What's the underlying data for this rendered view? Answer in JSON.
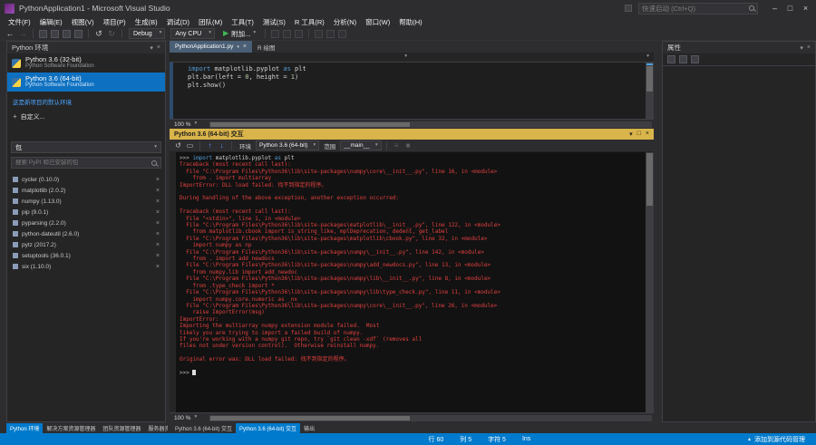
{
  "window": {
    "title": "PythonApplication1 - Microsoft Visual Studio"
  },
  "titlebar": {
    "quick_launch_placeholder": "快速启动 (Ctrl+Q)"
  },
  "menubar": {
    "items": [
      "文件(F)",
      "编辑(E)",
      "视图(V)",
      "项目(P)",
      "生成(B)",
      "调试(D)",
      "团队(M)",
      "工具(T)",
      "测试(S)",
      "R 工具(R)",
      "分析(N)",
      "窗口(W)",
      "帮助(H)"
    ]
  },
  "toolbar": {
    "config_combo": "Debug",
    "platform_combo": "Any CPU",
    "attach_label": "附加..."
  },
  "env_panel": {
    "title": "Python 环境",
    "environments": [
      {
        "name": "Python 3.6 (32-bit)",
        "vendor": "Python Software Foundation",
        "selected": false
      },
      {
        "name": "Python 3.6 (64-bit)",
        "vendor": "Python Software Foundation",
        "selected": true
      }
    ],
    "default_note": "这是新项目的默认环境",
    "customize_label": "自定义...",
    "view_combo": "包",
    "search_placeholder": "搜索 PyPI 和已安装的包",
    "packages": [
      {
        "name": "cycler (0.10.0)"
      },
      {
        "name": "matplotlib (2.0.2)"
      },
      {
        "name": "numpy (1.13.0)"
      },
      {
        "name": "pip (9.0.1)"
      },
      {
        "name": "pyparsing (2.2.0)"
      },
      {
        "name": "python-dateutil (2.6.0)"
      },
      {
        "name": "pytz (2017.2)"
      },
      {
        "name": "setuptools (36.0.1)"
      },
      {
        "name": "six (1.10.0)"
      }
    ]
  },
  "editor": {
    "tabs": [
      {
        "label": "PythonApplication1.py",
        "active": true
      },
      {
        "label": "R 绘图",
        "active": false
      }
    ],
    "zoom": "100 %",
    "code_lines": [
      {
        "tokens": [
          {
            "c": "kw",
            "t": "import"
          },
          {
            "c": "id",
            "t": " matplotlib.pyplot "
          },
          {
            "c": "kw",
            "t": "as"
          },
          {
            "c": "id",
            "t": " plt"
          }
        ]
      },
      {
        "tokens": [
          {
            "c": "id",
            "t": "plt.bar(left = "
          },
          {
            "c": "num",
            "t": "0"
          },
          {
            "c": "id",
            "t": ", height = "
          },
          {
            "c": "num",
            "t": "1"
          },
          {
            "c": "id",
            "t": ")"
          }
        ]
      },
      {
        "tokens": [
          {
            "c": "id",
            "t": "plt.show()"
          }
        ]
      }
    ]
  },
  "interactive": {
    "title": "Python 3.6 (64-bit) 交互",
    "env_label": "环境",
    "env_value": "Python 3.6 (64-bit)",
    "scope_label": "范围",
    "scope_value": "__main__",
    "zoom": "100 %",
    "lines": [
      {
        "c": "in",
        "tokens": [
          {
            "c": "prompt",
            "t": ">>> "
          },
          {
            "c": "kw",
            "t": "import"
          },
          {
            "c": "id",
            "t": " matplotlib.pyplot "
          },
          {
            "c": "kw",
            "t": "as"
          },
          {
            "c": "id",
            "t": " plt"
          }
        ]
      },
      {
        "c": "err",
        "t": "Traceback (most recent call last):"
      },
      {
        "c": "err",
        "t": "  File \"C:\\Program Files\\Python36\\lib\\site-packages\\numpy\\core\\__init__.py\", line 16, in <module>"
      },
      {
        "c": "err",
        "t": "    from . import multiarray"
      },
      {
        "c": "err",
        "t": "ImportError: DLL load failed: 找不到指定的程序。"
      },
      {
        "c": "blank",
        "t": ""
      },
      {
        "c": "err",
        "t": "During handling of the above exception, another exception occurred:"
      },
      {
        "c": "blank",
        "t": ""
      },
      {
        "c": "err",
        "t": "Traceback (most recent call last):"
      },
      {
        "c": "err",
        "t": "  File \"<stdin>\", line 1, in <module>"
      },
      {
        "c": "err",
        "t": "  File \"C:\\Program Files\\Python36\\lib\\site-packages\\matplotlib\\__init__.py\", line 122, in <module>"
      },
      {
        "c": "err",
        "t": "    from matplotlib.cbook import is_string_like, mplDeprecation, dedent, get_label"
      },
      {
        "c": "err",
        "t": "  File \"C:\\Program Files\\Python36\\lib\\site-packages\\matplotlib\\cbook.py\", line 32, in <module>"
      },
      {
        "c": "err",
        "t": "    import numpy as np"
      },
      {
        "c": "err",
        "t": "  File \"C:\\Program Files\\Python36\\lib\\site-packages\\numpy\\__init__.py\", line 142, in <module>"
      },
      {
        "c": "err",
        "t": "    from . import add_newdocs"
      },
      {
        "c": "err",
        "t": "  File \"C:\\Program Files\\Python36\\lib\\site-packages\\numpy\\add_newdocs.py\", line 13, in <module>"
      },
      {
        "c": "err",
        "t": "    from numpy.lib import add_newdoc"
      },
      {
        "c": "err",
        "t": "  File \"C:\\Program Files\\Python36\\lib\\site-packages\\numpy\\lib\\__init__.py\", line 8, in <module>"
      },
      {
        "c": "err",
        "t": "    from .type_check import *"
      },
      {
        "c": "err",
        "t": "  File \"C:\\Program Files\\Python36\\lib\\site-packages\\numpy\\lib\\type_check.py\", line 11, in <module>"
      },
      {
        "c": "err",
        "t": "    import numpy.core.numeric as _nx"
      },
      {
        "c": "err",
        "t": "  File \"C:\\Program Files\\Python36\\lib\\site-packages\\numpy\\core\\__init__.py\", line 26, in <module>"
      },
      {
        "c": "err",
        "t": "    raise ImportError(msg)"
      },
      {
        "c": "err",
        "t": "ImportError:"
      },
      {
        "c": "err",
        "t": "Importing the multiarray numpy extension module failed.  Most"
      },
      {
        "c": "err",
        "t": "likely you are trying to import a failed build of numpy."
      },
      {
        "c": "err",
        "t": "If you're working with a numpy git repo, try `git clean -xdf` (removes all"
      },
      {
        "c": "err",
        "t": "files not under version control).  Otherwise reinstall numpy."
      },
      {
        "c": "blank",
        "t": ""
      },
      {
        "c": "err",
        "t": "Original error was: DLL load failed: 找不到指定的程序。"
      },
      {
        "c": "blank",
        "t": ""
      },
      {
        "c": "prompt",
        "tokens": [
          {
            "c": "prompt",
            "t": ">>> "
          }
        ],
        "cursor": true
      }
    ]
  },
  "props_panel": {
    "title": "属性"
  },
  "bottom_tabs": {
    "left": [
      {
        "label": "Python 环境",
        "active": true
      },
      {
        "label": "解决方案资源管理器",
        "active": false
      },
      {
        "label": "团队资源管理器",
        "active": false
      },
      {
        "label": "服务器资源管理器",
        "active": false
      }
    ],
    "center": [
      {
        "label": "Python 3.6 (64-bit) 交互",
        "active": false
      },
      {
        "label": "Python 3.6 (64-bit) 交互",
        "active": true
      },
      {
        "label": "输出",
        "active": false
      }
    ]
  },
  "statusbar": {
    "line_label": "行 60",
    "col_label": "列 5",
    "char_label": "字符 5",
    "ins_label": "Ins",
    "source_control_label": "添加到源代码管理"
  },
  "icons": {
    "minimize": "–",
    "maximize": "□",
    "close": "×",
    "caret_down": "▾",
    "caret_up": "▴",
    "back": "←",
    "forward": "→",
    "undo": "↺",
    "redo": "↻",
    "play": "▶",
    "plus": "+",
    "reset": "↺",
    "clear": "▭",
    "up": "↑",
    "down": "↓",
    "menu": "≡",
    "stop": "■"
  },
  "colors": {
    "accent_blue": "#007acc",
    "selection_blue": "#0e70c0",
    "interactive_header_gold": "#d9b44a",
    "error_red": "#e0413e",
    "keyword_blue": "#569cd6",
    "number_green": "#b5cea8"
  }
}
